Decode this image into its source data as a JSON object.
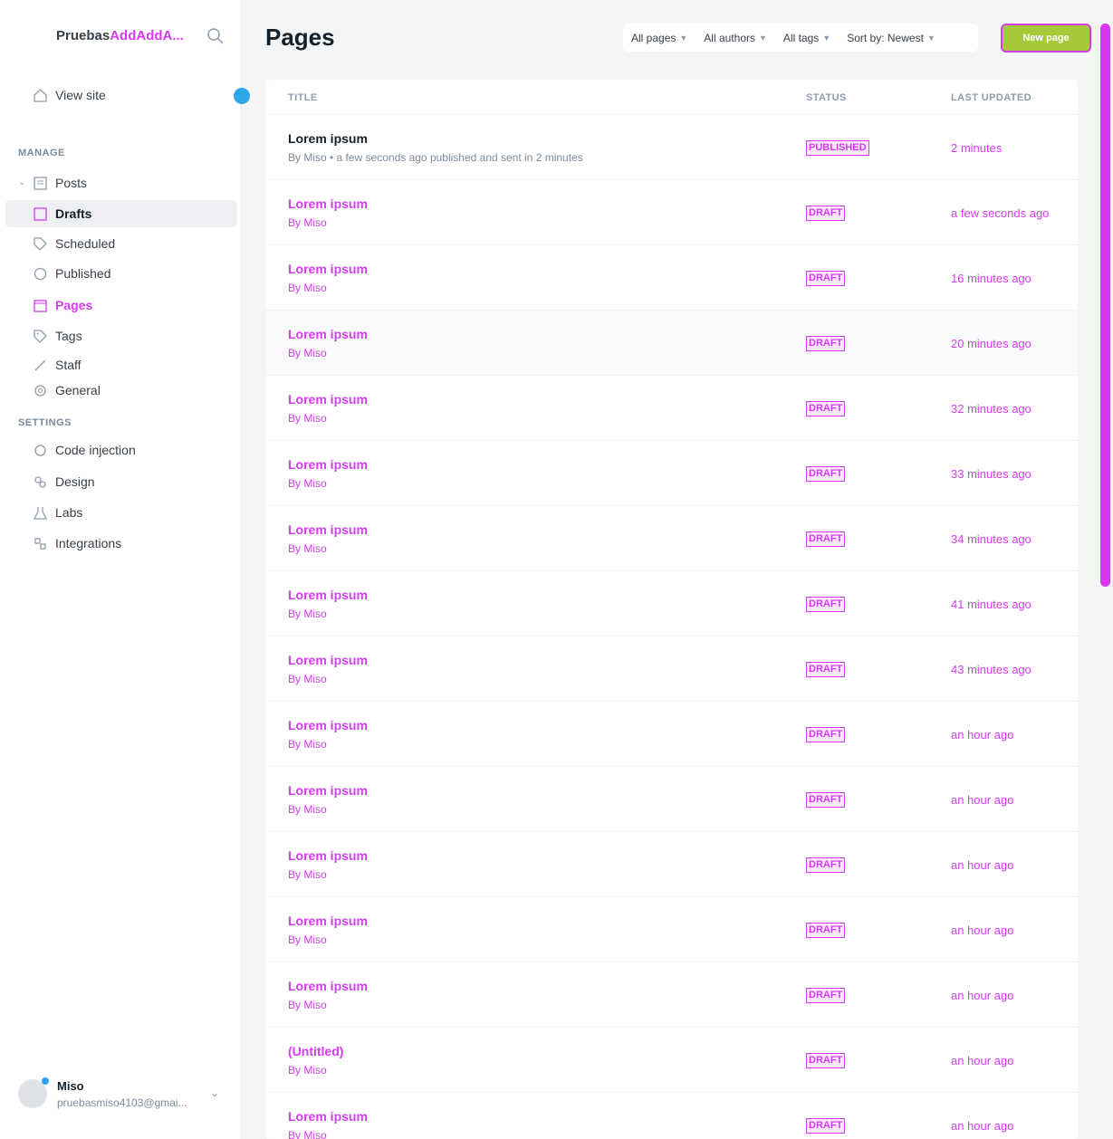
{
  "sidebar": {
    "site_name_part1": "Pruebas",
    "site_name_part2": "AddAddA...",
    "view_site": "View site",
    "manage_label": "MANAGE",
    "settings_label": "SETTINGS",
    "items": [
      {
        "label": "Posts",
        "icon": "posts-icon"
      },
      {
        "label": "Drafts",
        "icon": "drafts-icon"
      },
      {
        "label": "Scheduled",
        "icon": "scheduled-icon"
      },
      {
        "label": "Published",
        "icon": "published-icon"
      },
      {
        "label": "Pages",
        "icon": "pages-icon"
      },
      {
        "label": "Tags",
        "icon": "tags-icon"
      },
      {
        "label": "Staff",
        "icon": "staff-icon"
      }
    ],
    "settings": [
      {
        "label": "General",
        "icon": "gear-icon"
      },
      {
        "label": "Design",
        "icon": "design-icon"
      },
      {
        "label": "Code injection",
        "icon": "code-icon"
      },
      {
        "label": "Integrations",
        "icon": "integrations-icon"
      },
      {
        "label": "Labs",
        "icon": "labs-icon"
      }
    ],
    "user": {
      "name": "Miso",
      "email": "pruebasmiso4103@gmai..."
    }
  },
  "header": {
    "title": "Pages",
    "filters": [
      "All pages",
      "All authors",
      "All tags",
      "Sort by: Newest"
    ],
    "new_button": "New page"
  },
  "table": {
    "columns": [
      "TITLE",
      "STATUS",
      "LAST UPDATED"
    ],
    "rows": [
      {
        "title": "Lorem ipsum",
        "sub": "By Miso • a few seconds ago published and sent in 2 minutes",
        "status": "PUBLISHED",
        "time": "2 minutes"
      },
      {
        "title": "Lorem ipsum",
        "sub": "By Miso",
        "status": "DRAFT",
        "time": "a few seconds ago"
      },
      {
        "title": "Lorem ipsum",
        "sub": "By Miso",
        "status": "DRAFT",
        "time": "16 minutes ago"
      },
      {
        "title": "Lorem ipsum",
        "sub": "By Miso",
        "status": "DRAFT",
        "time": "20 minutes ago"
      },
      {
        "title": "Lorem ipsum",
        "sub": "By Miso",
        "status": "DRAFT",
        "time": "32 minutes ago"
      },
      {
        "title": "Lorem ipsum",
        "sub": "By Miso",
        "status": "DRAFT",
        "time": "33 minutes ago"
      },
      {
        "title": "Lorem ipsum",
        "sub": "By Miso",
        "status": "DRAFT",
        "time": "34 minutes ago"
      },
      {
        "title": "Lorem ipsum",
        "sub": "By Miso",
        "status": "DRAFT",
        "time": "41 minutes ago"
      },
      {
        "title": "Lorem ipsum",
        "sub": "By Miso",
        "status": "DRAFT",
        "time": "43 minutes ago"
      },
      {
        "title": "Lorem ipsum",
        "sub": "By Miso",
        "status": "DRAFT",
        "time": "an hour ago"
      },
      {
        "title": "Lorem ipsum",
        "sub": "By Miso",
        "status": "DRAFT",
        "time": "an hour ago"
      },
      {
        "title": "Lorem ipsum",
        "sub": "By Miso",
        "status": "DRAFT",
        "time": "an hour ago"
      },
      {
        "title": "Lorem ipsum",
        "sub": "By Miso",
        "status": "DRAFT",
        "time": "an hour ago"
      },
      {
        "title": "Lorem ipsum",
        "sub": "By Miso",
        "status": "DRAFT",
        "time": "an hour ago"
      },
      {
        "title": "(Untitled)",
        "sub": "By Miso",
        "status": "DRAFT",
        "time": "an hour ago"
      },
      {
        "title": "Lorem ipsum",
        "sub": "By Miso",
        "status": "DRAFT",
        "time": "an hour ago"
      }
    ]
  },
  "colors": {
    "accent": "#d63af0",
    "primary_button": "#a6c93a"
  }
}
